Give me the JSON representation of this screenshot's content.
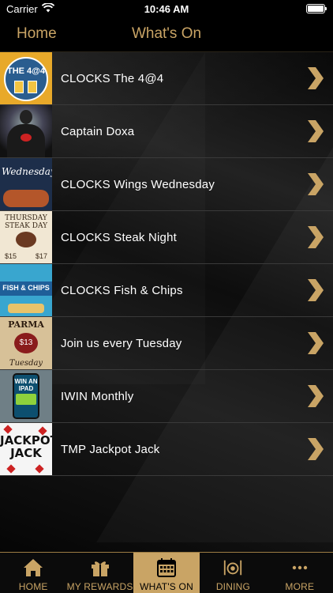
{
  "status_bar": {
    "carrier": "Carrier",
    "time": "10:46 AM",
    "battery_level": 1.0
  },
  "nav": {
    "back_label": "Home",
    "title": "What's On"
  },
  "colors": {
    "accent_gold": "#c9a465",
    "background": "#000000",
    "active_tab_bg": "#c9a465"
  },
  "events": [
    {
      "label": "CLOCKS The 4@4",
      "thumb_text": "THE 4@4"
    },
    {
      "label": "Captain Doxa"
    },
    {
      "label": "CLOCKS Wings Wednesday",
      "thumb_text": "Wednesday"
    },
    {
      "label": "CLOCKS Steak Night",
      "thumb_text": "THURSDAY STEAK DAY",
      "thumb_prices": [
        "$15",
        "$17"
      ]
    },
    {
      "label": "CLOCKS Fish & Chips",
      "thumb_text": "FISH & CHIPS"
    },
    {
      "label": "Join us every Tuesday",
      "thumb_text": "PARMA",
      "thumb_price": "$13",
      "thumb_sub": "Tuesday"
    },
    {
      "label": "IWIN Monthly",
      "thumb_text": "WIN AN IPAD"
    },
    {
      "label": "TMP Jackpot Jack",
      "thumb_text": "JACKPOT JACK"
    }
  ],
  "tabs": [
    {
      "label": "HOME",
      "icon": "home-icon",
      "active": false
    },
    {
      "label": "MY REWARDS",
      "icon": "gift-icon",
      "active": false
    },
    {
      "label": "WHAT'S ON",
      "icon": "calendar-icon",
      "active": true
    },
    {
      "label": "DINING",
      "icon": "dining-icon",
      "active": false
    },
    {
      "label": "MORE",
      "icon": "more-icon",
      "active": false
    }
  ]
}
